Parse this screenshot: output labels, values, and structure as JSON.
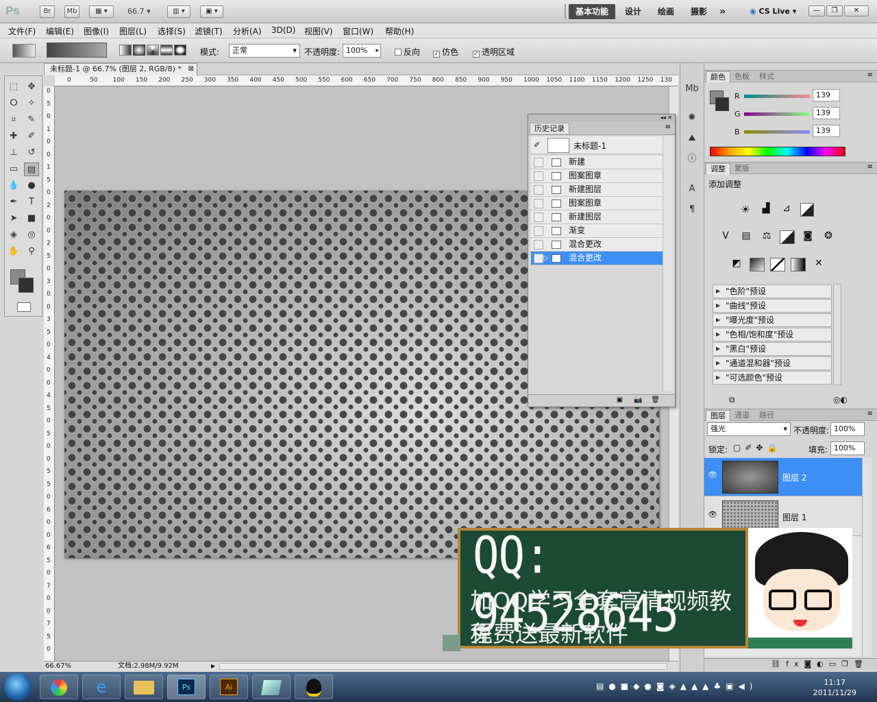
{
  "appbar": {
    "logo": "Ps",
    "bridge": "Br",
    "minibridge": "Mb",
    "zoom": "66.7",
    "workspaces": [
      "基本功能",
      "设计",
      "绘画",
      "摄影"
    ],
    "more": "»",
    "cslive": "CS Live"
  },
  "menubar": [
    "文件(F)",
    "编辑(E)",
    "图像(I)",
    "图层(L)",
    "选择(S)",
    "滤镜(T)",
    "分析(A)",
    "3D(D)",
    "视图(V)",
    "窗口(W)",
    "帮助(H)"
  ],
  "options": {
    "mode_label": "模式:",
    "mode_value": "正常",
    "opacity_label": "不透明度:",
    "opacity_value": "100%",
    "reverse": "反向",
    "dither": "仿色",
    "transparency": "透明区域"
  },
  "document": {
    "tab_title": "未标题-1 @ 66.7% (图层 2, RGB/8) *",
    "ruler_top": [
      "0",
      "50",
      "100",
      "150",
      "200",
      "250",
      "300",
      "350",
      "400",
      "450",
      "500",
      "550",
      "600",
      "650",
      "700",
      "750",
      "800",
      "850",
      "900",
      "950",
      "1000",
      "1050",
      "1100",
      "1150",
      "1200",
      "1250",
      "130"
    ],
    "ruler_left": [
      "0",
      "5",
      "0",
      "1",
      "0",
      "0",
      "1",
      "5",
      "0",
      "2",
      "0",
      "0",
      "2",
      "5",
      "0",
      "3",
      "0",
      "0",
      "3",
      "5",
      "0",
      "4",
      "0",
      "0",
      "4",
      "5",
      "0",
      "5",
      "0",
      "0",
      "5",
      "5",
      "0",
      "6",
      "0",
      "0",
      "6",
      "5",
      "0",
      "7",
      "0",
      "0",
      "7",
      "5",
      "0"
    ],
    "zoom_status": "66.67%",
    "doc_info": "文档:2.98M/9.92M"
  },
  "history": {
    "title": "历史记录",
    "snapshot": "未标题-1",
    "steps": [
      "新建",
      "图案图章",
      "新建图层",
      "图案图章",
      "新建图层",
      "渐变",
      "混合更改",
      "混合更改"
    ],
    "selected_index": 7
  },
  "color_panel": {
    "tabs": [
      "颜色",
      "色板",
      "样式"
    ],
    "channels": [
      {
        "name": "R",
        "value": "139"
      },
      {
        "name": "G",
        "value": "139"
      },
      {
        "name": "B",
        "value": "139"
      }
    ]
  },
  "adjust_panel": {
    "tabs": [
      "调整",
      "蒙版"
    ],
    "title": "添加调整",
    "presets": [
      "\"色阶\"预设",
      "\"曲线\"预设",
      "\"曝光度\"预设",
      "\"色相/饱和度\"预设",
      "\"黑白\"预设",
      "\"通道混和器\"预设",
      "\"可选颜色\"预设"
    ]
  },
  "layers_panel": {
    "tabs": [
      "图层",
      "通道",
      "路径"
    ],
    "blend_mode": "强光",
    "opacity_label": "不透明度:",
    "opacity_value": "100%",
    "lock_label": "锁定:",
    "fill_label": "填充:",
    "fill_value": "100%",
    "layers": [
      {
        "name": "图层 2",
        "selected": true
      },
      {
        "name": "图层 1",
        "selected": false
      }
    ]
  },
  "ad": {
    "qq": "QQ: 94528645",
    "line2": "加QQ学习全套高清视频教程",
    "line3": "免费送最新软件"
  },
  "taskbar": {
    "time": "11:17",
    "date": "2011/11/29",
    "apps": [
      "start",
      "explorer",
      "ie",
      "folder",
      "photoshop",
      "illustrator",
      "app",
      "qq"
    ]
  },
  "colors": {
    "selection": "#3d8ff5",
    "ad_bg": "#1c4a35",
    "ad_border": "#b8863b",
    "foreground": "#8b8b8b",
    "background": "#303030"
  }
}
